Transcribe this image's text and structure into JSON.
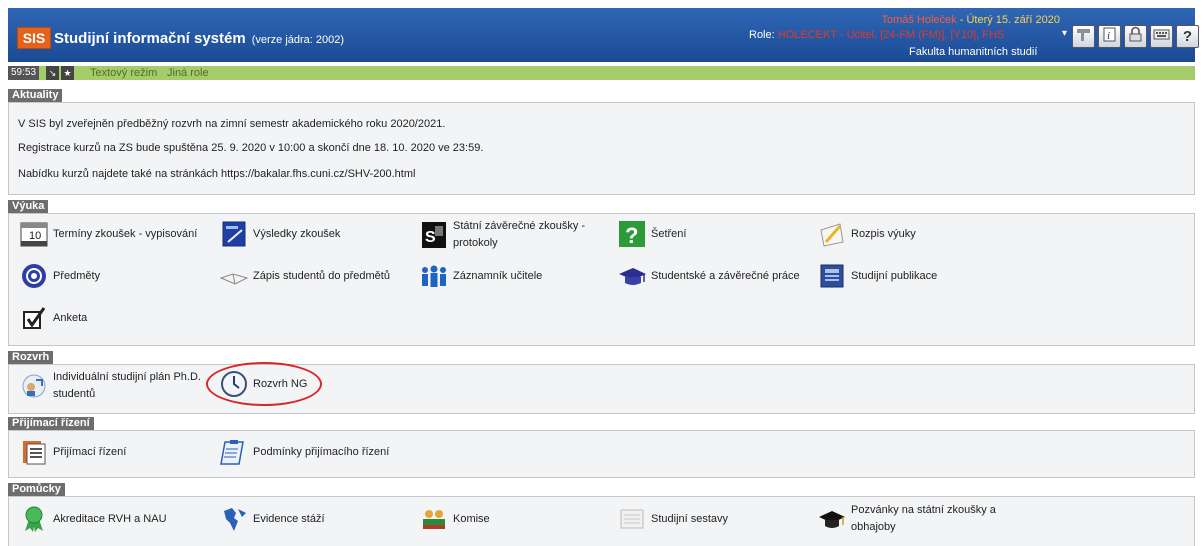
{
  "header": {
    "logo": "SIS",
    "title": "Studijní informační systém",
    "version": "(verze jádra: 2002)",
    "user_name": "Tomáš Holeček",
    "date": " - Úterý 15. září 2020",
    "role_label": "Role:",
    "role_value": "HOLECEKT - Učitel, [24-FM (FM)], [Y10], FHS",
    "faculty": "Fakulta humanitních studií",
    "toolbar": [
      "tools-icon",
      "info-icon",
      "lock-icon",
      "keyboard-icon",
      "help-icon"
    ]
  },
  "statusbar": {
    "timer": "59:53",
    "text_mode": "Textový režim",
    "other_role": "Jiná role"
  },
  "sections": {
    "news": {
      "title": "Aktuality",
      "lines": [
        "V SIS byl zveřejněn předběžný rozvrh na zimní semestr akademického roku 2020/2021.",
        "Registrace kurzů na ZS bude spuštěna 25. 9. 2020 v 10:00 a skončí dne 18. 10. 2020 ve 23:59.",
        "Nabídku kurzů najdete také na stránkách https://bakalar.fhs.cuni.cz/SHV-200.html"
      ]
    },
    "teaching": {
      "title": "Výuka",
      "items": [
        {
          "label": "Termíny zkoušek - vypisování",
          "icon": "calendar-icon"
        },
        {
          "label": "Výsledky zkoušek",
          "icon": "index-book-icon"
        },
        {
          "label": "Státní závěrečné zkoušky - protokoly",
          "icon": "sz-protocol-icon"
        },
        {
          "label": "Šetření",
          "icon": "question-icon"
        },
        {
          "label": "Rozpis výuky",
          "icon": "pencil-paper-icon"
        },
        {
          "label": "Předměty",
          "icon": "subjects-icon"
        },
        {
          "label": "Zápis studentů do předmětů",
          "icon": "open-book-icon"
        },
        {
          "label": "Záznamník učitele",
          "icon": "people-icon"
        },
        {
          "label": "Studentské a závěrečné práce",
          "icon": "graduation-cap-icon"
        },
        {
          "label": "Studijní publikace",
          "icon": "publication-icon"
        },
        {
          "label": "Anketa",
          "icon": "checkbox-icon"
        }
      ]
    },
    "schedule": {
      "title": "Rozvrh",
      "items": [
        {
          "label": "Individuální studijní plán Ph.D. studentů",
          "icon": "study-plan-icon"
        },
        {
          "label": "Rozvrh NG",
          "icon": "clock-icon"
        }
      ]
    },
    "admission": {
      "title": "Přijímací řízení",
      "items": [
        {
          "label": "Přijímací řízení",
          "icon": "forms-icon"
        },
        {
          "label": "Podmínky přijímacího řízení",
          "icon": "clipboard-icon"
        }
      ]
    },
    "tools": {
      "title": "Pomůcky",
      "items": [
        {
          "label": "Akreditace RVH a NAU",
          "icon": "award-ribbon-icon"
        },
        {
          "label": "Evidence stáží",
          "icon": "globe-icon"
        },
        {
          "label": "Komise",
          "icon": "committee-icon"
        },
        {
          "label": "Studijní sestavy",
          "icon": "reports-icon"
        },
        {
          "label": "Pozvánky na státní zkoušky a obhajoby",
          "icon": "mortarboard-icon"
        }
      ]
    }
  }
}
